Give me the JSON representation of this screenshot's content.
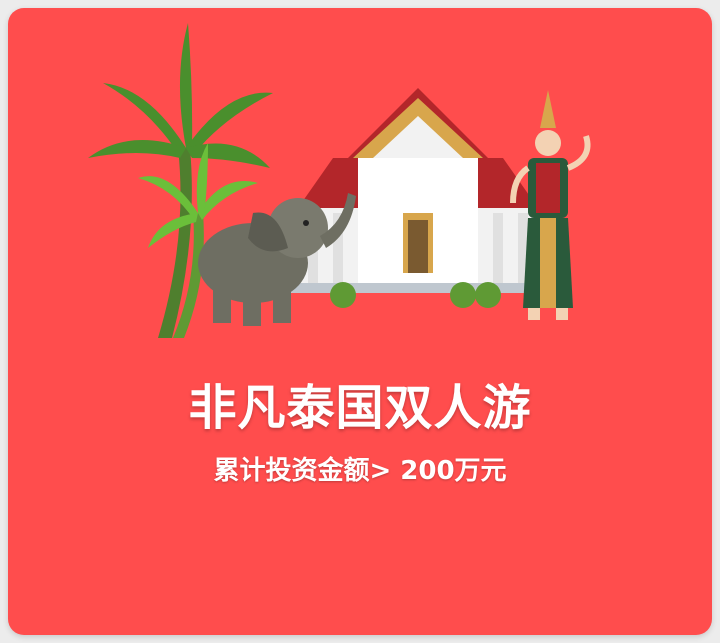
{
  "colors": {
    "card_background": "#ff4d4d",
    "text": "#ffffff",
    "palm_dark": "#4a8f2d",
    "palm_light": "#6bbf3a",
    "elephant": "#6e6e62",
    "temple_roof": "#b3262a",
    "temple_gold": "#d8a64c",
    "temple_wall": "#f2f2f2",
    "dancer_dress": "#2a5a3b"
  },
  "icons": [
    "palm-tree-icon",
    "elephant-icon",
    "thai-temple-icon",
    "thai-dancer-icon"
  ],
  "card": {
    "title": "非凡泰国双人游",
    "subtitle": "累计投资金额> 200万元"
  }
}
